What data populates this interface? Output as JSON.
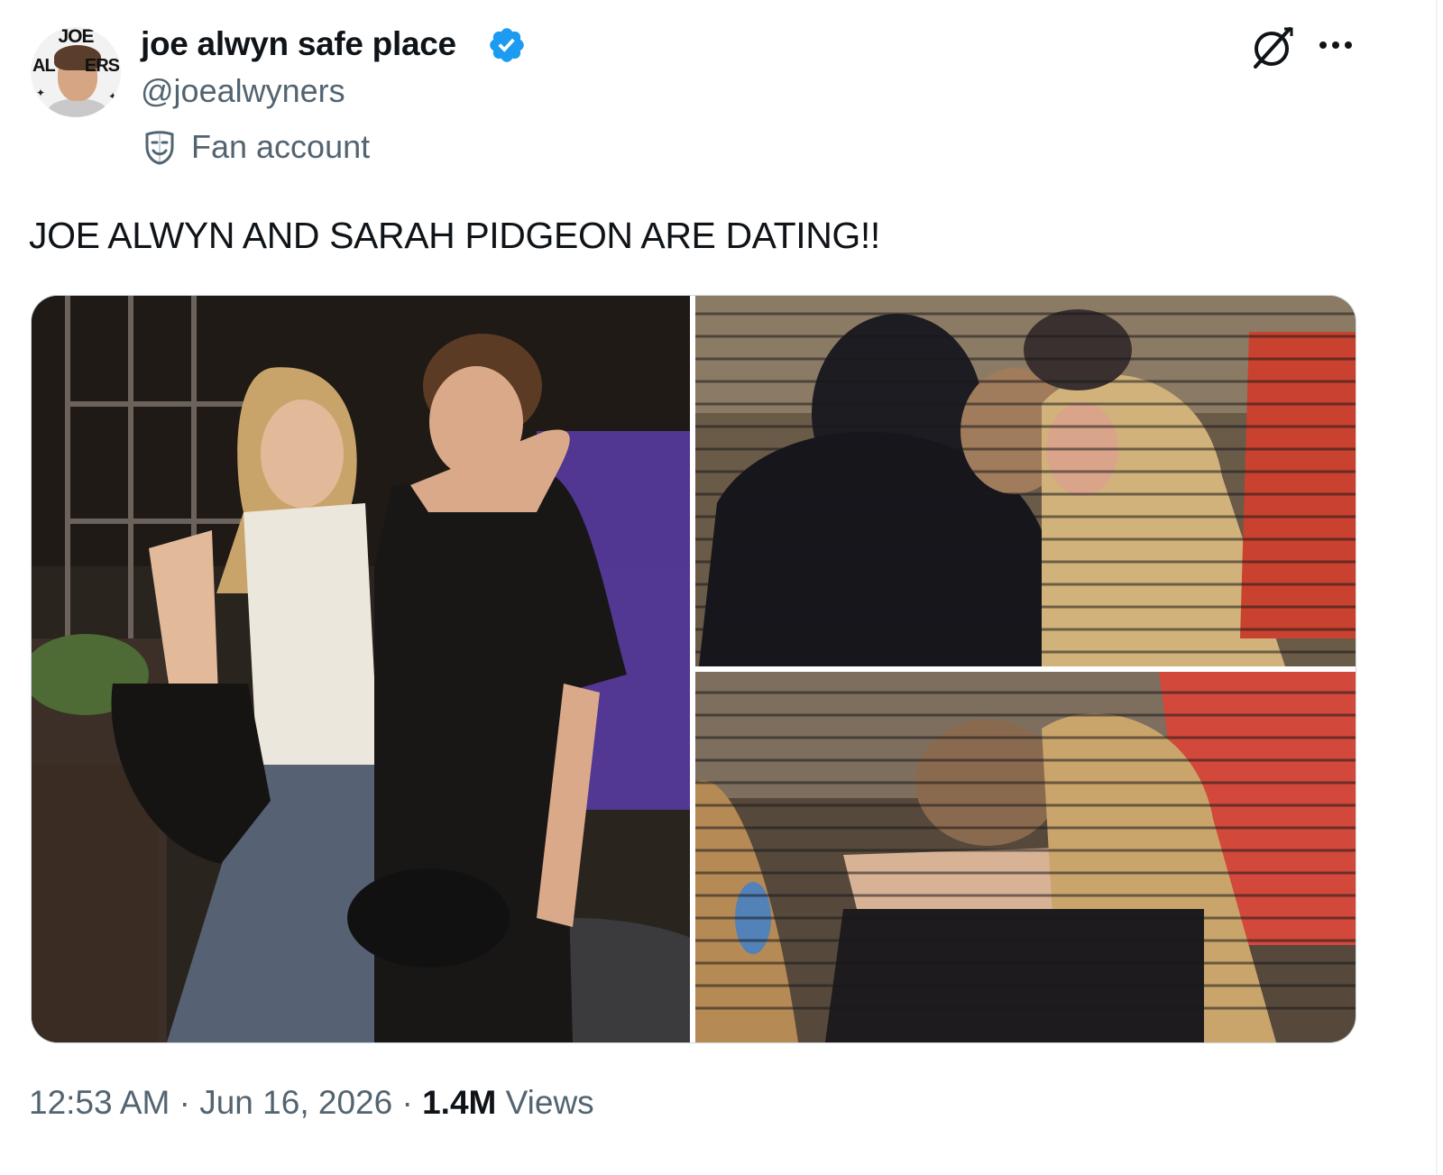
{
  "author": {
    "avatar_text_top": "JOE",
    "avatar_text_left": "AL",
    "avatar_text_right": "ERS",
    "display_name": "joe alwyn safe place",
    "handle": "@joealwyners",
    "verified_icon": "verified-badge-icon",
    "label": "Fan account",
    "label_icon": "theater-masks-icon"
  },
  "actions": {
    "grok_icon": "grok-icon",
    "more_icon": "more-horizontal-icon"
  },
  "post": {
    "text": "JOE ALWYN AND SARAH PIDGEON ARE DATING!!",
    "images": [
      {
        "description_icon": "photo-couple-walking"
      },
      {
        "description_icon": "photo-couple-kissing-1"
      },
      {
        "description_icon": "photo-couple-kissing-2"
      }
    ]
  },
  "meta": {
    "time": "12:53 AM",
    "separator": "·",
    "date": "Jun 16, 2026",
    "views_count": "1.4M",
    "views_label": "Views"
  },
  "colors": {
    "text_primary": "#0f1419",
    "text_secondary": "#536471",
    "verified_blue": "#1d9bf0",
    "border": "#cfd9de"
  }
}
